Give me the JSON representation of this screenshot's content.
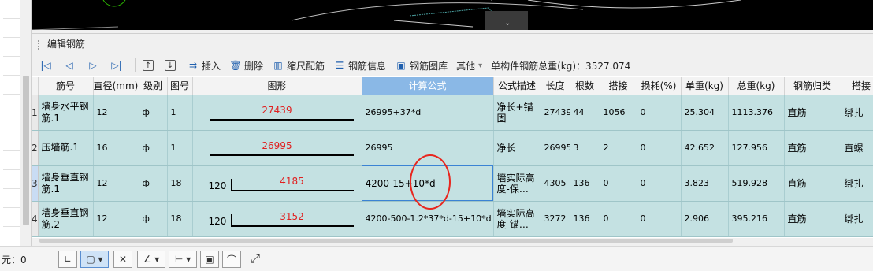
{
  "panel": {
    "title": "编辑钢筋"
  },
  "toolbar": {
    "nav": [
      {
        "name": "first-record-icon",
        "glyph": "|◁"
      },
      {
        "name": "prev-record-icon",
        "glyph": "◁"
      },
      {
        "name": "next-record-icon",
        "glyph": "▷"
      },
      {
        "name": "last-record-icon",
        "glyph": "▷|"
      }
    ],
    "move_up_glyph": "↑",
    "move_down_glyph": "↓",
    "insert_label": "插入",
    "delete_label": "删除",
    "scale_label": "缩尺配筋",
    "info_label": "钢筋信息",
    "library_label": "钢筋图库",
    "more_label": "其他",
    "more_caret": "▾",
    "total_label": "单构件钢筋总重(kg)：3527.074"
  },
  "table": {
    "columns": [
      "筋号",
      "直径(mm)",
      "级别",
      "图号",
      "图形",
      "计算公式",
      "公式描述",
      "长度",
      "根数",
      "搭接",
      "损耗(%)",
      "单重(kg)",
      "总重(kg)",
      "钢筋归类",
      "搭接"
    ],
    "rows": [
      {
        "index": "1",
        "name": "墙身水平钢筋.1",
        "diameter": "12",
        "grade": "ф",
        "fig_no": "1",
        "shape_value": "27439",
        "hook": "",
        "formula": "26995+37*d",
        "desc": "净长+锚固",
        "length": "27439",
        "count": "44",
        "lap": "1056",
        "loss": "0",
        "unit_weight": "25.304",
        "total_weight": "1113.376",
        "category": "直筋",
        "lap_type": "绑扎"
      },
      {
        "index": "2",
        "name": "压墙筋.1",
        "diameter": "16",
        "grade": "ф",
        "fig_no": "1",
        "shape_value": "26995",
        "hook": "",
        "formula": "26995",
        "desc": "净长",
        "length": "26995",
        "count": "3",
        "lap": "2",
        "loss": "0",
        "unit_weight": "42.652",
        "total_weight": "127.956",
        "category": "直筋",
        "lap_type": "直螺"
      },
      {
        "index": "3",
        "name": "墙身垂直钢筋.1",
        "diameter": "12",
        "grade": "ф",
        "fig_no": "18",
        "shape_value": "4185",
        "hook": "120",
        "formula": "4200-15+10*d",
        "desc": "墙实际高度-保…",
        "length": "4305",
        "count": "136",
        "lap": "0",
        "loss": "0",
        "unit_weight": "3.823",
        "total_weight": "519.928",
        "category": "直筋",
        "lap_type": "绑扎"
      },
      {
        "index": "4",
        "name": "墙身垂直钢筋.2",
        "diameter": "12",
        "grade": "ф",
        "fig_no": "18",
        "shape_value": "3152",
        "hook": "120",
        "formula": "4200-500-1.2*37*d-15+10*d",
        "desc": "墙实际高度-锚…",
        "length": "3272",
        "count": "136",
        "lap": "0",
        "loss": "0",
        "unit_weight": "2.906",
        "total_weight": "395.216",
        "category": "直筋",
        "lap_type": "绑扎"
      }
    ]
  },
  "status": {
    "label": "元：0"
  },
  "colors": {
    "accent": "#3b83d4",
    "row_bg": "#c4e1e2",
    "shape_value": "#e02020",
    "annotation": "#e8261e"
  }
}
